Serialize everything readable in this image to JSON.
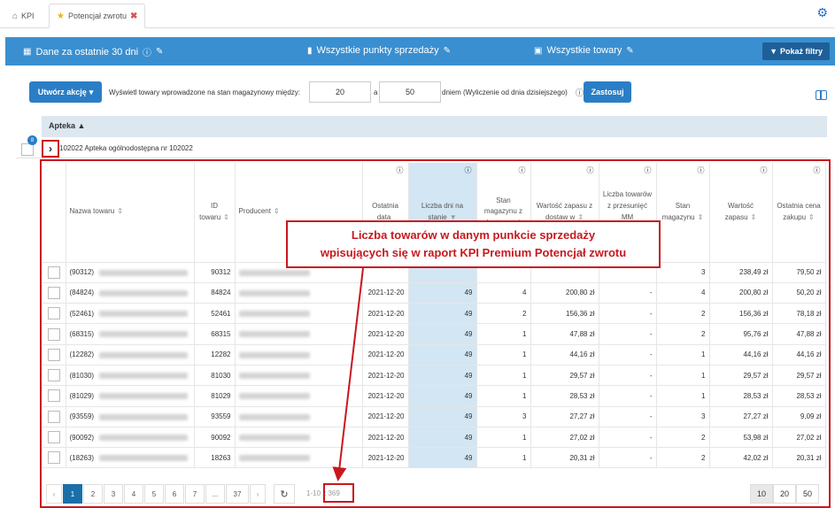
{
  "tabs": [
    {
      "label": "KPI",
      "icon": "home-icon"
    },
    {
      "label": "Potencjał zwrotu",
      "icon": "star-icon",
      "closable": true
    }
  ],
  "filterbar": {
    "period": "Dane za ostatnie 30 dni",
    "points": "Wszystkie punkty sprzedaży",
    "products": "Wszystkie towary",
    "show_filters": "Pokaż filtry"
  },
  "toolbar": {
    "create_action": "Utwórz akcję",
    "label_between": "Wyświetl towary wprowadzone na stan magazynowy między:",
    "from_value": "20",
    "label_and": "a",
    "to_value": "50",
    "label_days": "dniem (Wyliczenie od dnia dzisiejszego)",
    "apply": "Zastosuj"
  },
  "group": {
    "header": "Apteka",
    "badge": "8",
    "label": "102022 Apteka ogólnodostępna nr 102022"
  },
  "table": {
    "columns": [
      {
        "label": "Nazwa towaru",
        "sort": "⇕",
        "info": false
      },
      {
        "label": "ID towaru",
        "sort": "⇕",
        "info": false
      },
      {
        "label": "Producent",
        "sort": "⇕",
        "info": false
      },
      {
        "label": "Ostatnia data",
        "sort": "",
        "info": true
      },
      {
        "label": "Liczba dni na stanie",
        "sort": "▼",
        "info": true
      },
      {
        "label": "Stan magazynu z dostaw w",
        "sort": "⇕",
        "info": true
      },
      {
        "label": "Wartość zapasu z dostaw w",
        "sort": "⇕",
        "info": true
      },
      {
        "label": "Liczba towarów z przesunięć MM (przychód)",
        "sort": "⇕",
        "info": true
      },
      {
        "label": "Stan magazynu",
        "sort": "⇕",
        "info": true
      },
      {
        "label": "Wartość zapasu",
        "sort": "⇕",
        "info": true
      },
      {
        "label": "Ostatnia cena zakupu",
        "sort": "⇕",
        "info": true
      }
    ],
    "rows": [
      {
        "name": "(90312)",
        "id": "90312",
        "date": "",
        "days": "",
        "stock_d": "",
        "value_d": "",
        "mm": "",
        "stock": "3",
        "value": "238,49 zł",
        "price": "79,50 zł"
      },
      {
        "name": "(84824)",
        "id": "84824",
        "date": "2021-12-20",
        "days": "49",
        "stock_d": "4",
        "value_d": "200,80 zł",
        "mm": "-",
        "stock": "4",
        "value": "200,80 zł",
        "price": "50,20 zł"
      },
      {
        "name": "(52461)",
        "id": "52461",
        "date": "2021-12-20",
        "days": "49",
        "stock_d": "2",
        "value_d": "156,36 zł",
        "mm": "-",
        "stock": "2",
        "value": "156,36 zł",
        "price": "78,18 zł"
      },
      {
        "name": "(68315)",
        "id": "68315",
        "date": "2021-12-20",
        "days": "49",
        "stock_d": "1",
        "value_d": "47,88 zł",
        "mm": "-",
        "stock": "2",
        "value": "95,76 zł",
        "price": "47,88 zł"
      },
      {
        "name": "(12282)",
        "id": "12282",
        "date": "2021-12-20",
        "days": "49",
        "stock_d": "1",
        "value_d": "44,16 zł",
        "mm": "-",
        "stock": "1",
        "value": "44,16 zł",
        "price": "44,16 zł"
      },
      {
        "name": "(81030)",
        "id": "81030",
        "date": "2021-12-20",
        "days": "49",
        "stock_d": "1",
        "value_d": "29,57 zł",
        "mm": "-",
        "stock": "1",
        "value": "29,57 zł",
        "price": "29,57 zł"
      },
      {
        "name": "(81029)",
        "id": "81029",
        "date": "2021-12-20",
        "days": "49",
        "stock_d": "1",
        "value_d": "28,53 zł",
        "mm": "-",
        "stock": "1",
        "value": "28,53 zł",
        "price": "28,53 zł"
      },
      {
        "name": "(93559)",
        "id": "93559",
        "date": "2021-12-20",
        "days": "49",
        "stock_d": "3",
        "value_d": "27,27 zł",
        "mm": "-",
        "stock": "3",
        "value": "27,27 zł",
        "price": "9,09 zł"
      },
      {
        "name": "(90092)",
        "id": "90092",
        "date": "2021-12-20",
        "days": "49",
        "stock_d": "1",
        "value_d": "27,02 zł",
        "mm": "-",
        "stock": "2",
        "value": "53,98 zł",
        "price": "27,02 zł"
      },
      {
        "name": "(18263)",
        "id": "18263",
        "date": "2021-12-20",
        "days": "49",
        "stock_d": "1",
        "value_d": "20,31 zł",
        "mm": "-",
        "stock": "2",
        "value": "42,02 zł",
        "price": "20,31 zł"
      }
    ]
  },
  "annotation": {
    "line1": "Liczba towarów w danym punkcie sprzedaży",
    "line2": "wpisujących się w raport KPI Premium Potencjał zwrotu"
  },
  "pagination": {
    "prev": "‹",
    "pages": [
      "1",
      "2",
      "3",
      "4",
      "5",
      "6",
      "7",
      "...",
      "37"
    ],
    "next": "›",
    "range": "1-10 z 369",
    "page_sizes": [
      "10",
      "20",
      "50"
    ]
  },
  "colors": {
    "accent": "#3a8fd0",
    "highlight": "#c8181e",
    "sorted_col": "#d3e6f3"
  }
}
